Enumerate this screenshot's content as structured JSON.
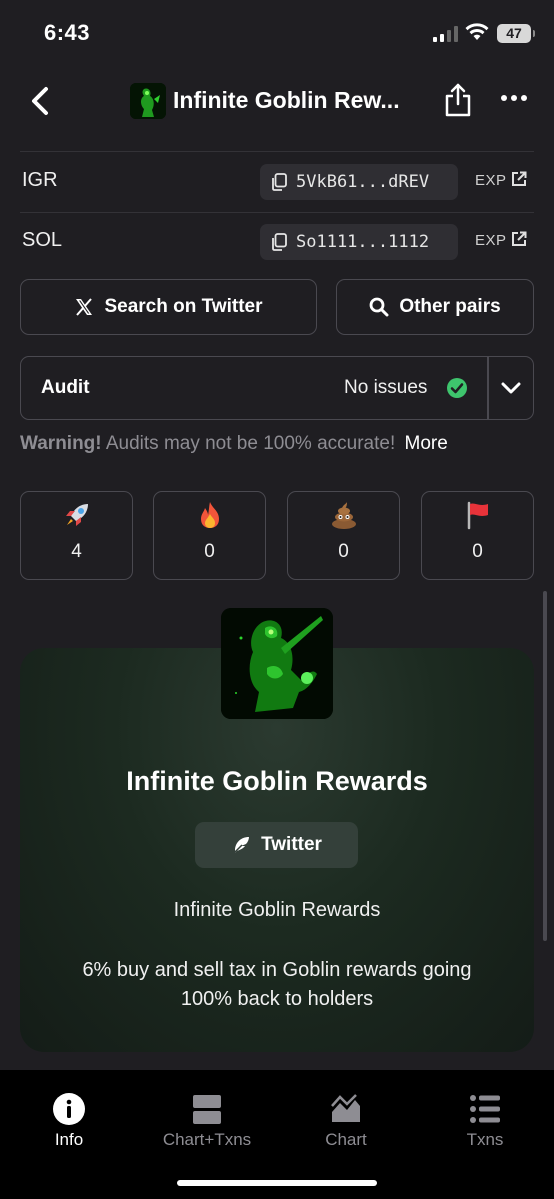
{
  "status_bar": {
    "time": "6:43",
    "battery": "47"
  },
  "header": {
    "title": "Infinite Goblin Rew..."
  },
  "addresses": [
    {
      "label": "IGR",
      "address": "5VkB61...dREV",
      "link": "EXP"
    },
    {
      "label": "SOL",
      "address": "So1111...1112",
      "link": "EXP"
    }
  ],
  "actions": {
    "twitter_search": "Search on Twitter",
    "other_pairs": "Other pairs"
  },
  "audit": {
    "label": "Audit",
    "status": "No issues"
  },
  "warning": {
    "prefix": "Warning!",
    "text": "Audits may not be 100% accurate!",
    "more": "More"
  },
  "reactions": [
    {
      "icon": "rocket-icon",
      "count": "4"
    },
    {
      "icon": "fire-icon",
      "count": "0"
    },
    {
      "icon": "poop-icon",
      "count": "0"
    },
    {
      "icon": "red-flag-icon",
      "count": "0"
    }
  ],
  "token": {
    "title": "Infinite Goblin Rewards",
    "twitter_label": "Twitter",
    "name": "Infinite Goblin Rewards",
    "description": "6% buy and sell tax in Goblin rewards going  100% back to holders"
  },
  "tabs": [
    {
      "label": "Info",
      "active": true
    },
    {
      "label": "Chart+Txns",
      "active": false
    },
    {
      "label": "Chart",
      "active": false
    },
    {
      "label": "Txns",
      "active": false
    }
  ],
  "colors": {
    "background": "#1f1e22",
    "border": "#4a4950",
    "success": "#3ec46d",
    "card": "#1c2a20"
  }
}
